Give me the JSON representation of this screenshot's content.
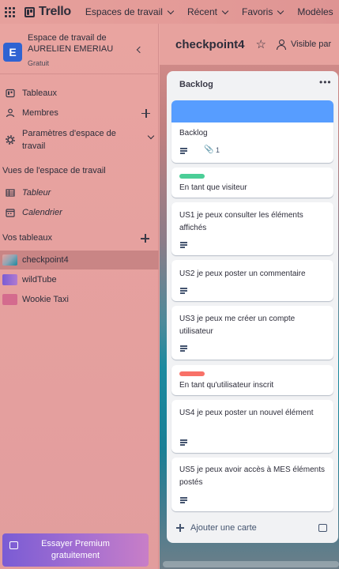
{
  "topbar": {
    "logo": "Trello",
    "nav": [
      "Espaces de travail",
      "Récent",
      "Favoris",
      "Modèles"
    ]
  },
  "workspace": {
    "avatar_letter": "E",
    "name": "Espace de travail de AURELIEN EMERIAU",
    "plan": "Gratuit"
  },
  "sidebar": {
    "items": [
      {
        "label": "Tableaux",
        "icon": "board-icon"
      },
      {
        "label": "Membres",
        "icon": "person-icon"
      },
      {
        "label": "Paramètres d'espace de travail",
        "icon": "gear-icon"
      }
    ],
    "views_title": "Vues de l'espace de travail",
    "views": [
      {
        "label": "Tableur",
        "icon": "table-icon"
      },
      {
        "label": "Calendrier",
        "icon": "calendar-icon"
      }
    ],
    "boards_title": "Vos tableaux",
    "boards": [
      {
        "label": "checkpoint4",
        "color": "#4c8fa6"
      },
      {
        "label": "wildTube",
        "color": "#8a6fd6"
      },
      {
        "label": "Wookie Taxi",
        "color": "#d46b8e"
      }
    ],
    "premium_label": "Essayer Premium gratuitement"
  },
  "board": {
    "title": "checkpoint4",
    "visibility": "Visible par",
    "list": {
      "title": "Backlog",
      "menu_icon": "more-icon",
      "cards": [
        {
          "text": "Backlog",
          "cover_color": "#579dff",
          "attachments": "1"
        },
        {
          "text": "En tant que visiteur",
          "label_color": "#4bce97"
        },
        {
          "text": "US1 je peux consulter les éléments affichés"
        },
        {
          "text": "US2 je peux poster un commentaire"
        },
        {
          "text": "US3 je peux me créer un compte utilisateur"
        },
        {
          "text": "En tant qu'utilisateur inscrit",
          "label_color": "#f87168"
        },
        {
          "text": "US4 je peux poster un nouvel élément"
        },
        {
          "text": "US5 je peux avoir accès à MES éléments postés"
        }
      ],
      "add_card_label": "Ajouter une carte"
    }
  }
}
